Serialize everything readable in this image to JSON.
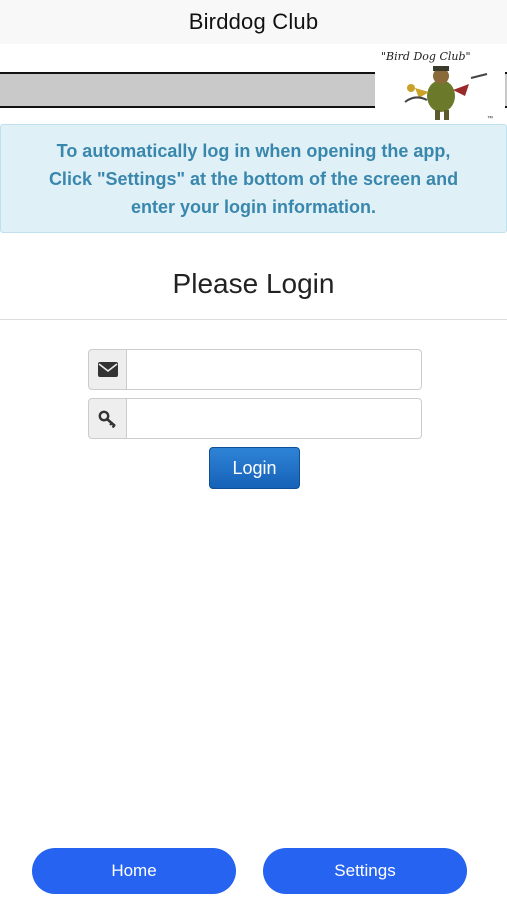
{
  "header": {
    "title": "Birddog Club"
  },
  "banner": {
    "logo_text": "\"Bird Dog Club\"",
    "logo_mark": "™"
  },
  "info": {
    "lines": [
      "To automatically log in when opening the app,",
      "Click \"Settings\" at the bottom of the screen and",
      "enter your login information."
    ],
    "color": "#3a87ad",
    "background": "#dff0f7"
  },
  "login": {
    "heading": "Please Login",
    "email": {
      "icon": "envelope-icon",
      "value": "",
      "placeholder": ""
    },
    "password": {
      "icon": "key-icon",
      "value": "",
      "placeholder": ""
    },
    "button_label": "Login",
    "button_color": "#1a6cc5"
  },
  "footer": {
    "home_label": "Home",
    "settings_label": "Settings",
    "button_color": "#2563f0"
  }
}
